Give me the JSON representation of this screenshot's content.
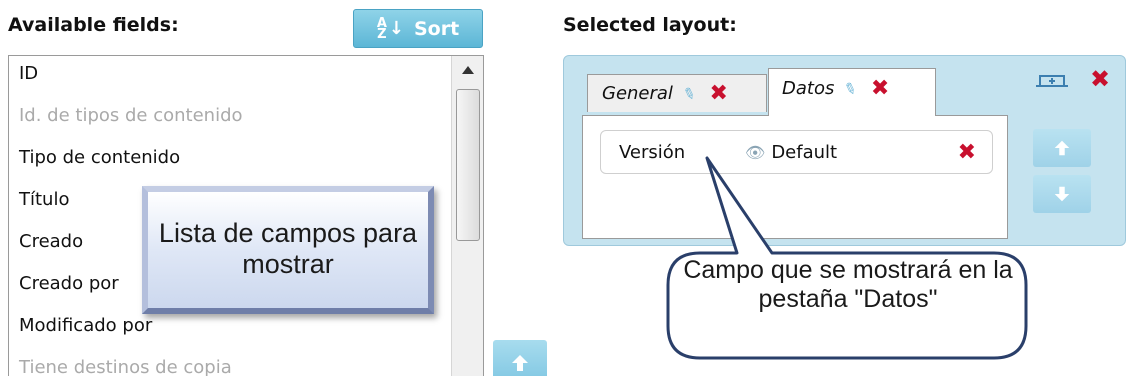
{
  "available": {
    "heading": "Available fields:",
    "sort_label": "Sort",
    "sort_glyph_top": "A",
    "sort_glyph_bottom": "Z",
    "fields": [
      {
        "label": "ID",
        "enabled": true
      },
      {
        "label": "Id. de tipos de contenido",
        "enabled": false
      },
      {
        "label": "Tipo de contenido",
        "enabled": true
      },
      {
        "label": "Título",
        "enabled": true
      },
      {
        "label": "Creado",
        "enabled": true
      },
      {
        "label": "Creado por",
        "enabled": true
      },
      {
        "label": "Modificado por",
        "enabled": true
      },
      {
        "label": "Tiene destinos de copia",
        "enabled": false
      }
    ]
  },
  "selected": {
    "heading": "Selected layout:",
    "tabs": [
      {
        "label": "General",
        "active": false
      },
      {
        "label": "Datos",
        "active": true
      }
    ],
    "field_chip": {
      "name": "Versión",
      "visibility": "Default"
    }
  },
  "callouts": {
    "left": "Lista de campos para mostrar",
    "right": "Campo que se mostrará en la pestaña \"Datos\""
  },
  "colors": {
    "accent": "#5cb6d6",
    "panel_bg": "#c5e3ef",
    "remove_red": "#c8102e",
    "disabled_text": "#aaaaaa"
  }
}
